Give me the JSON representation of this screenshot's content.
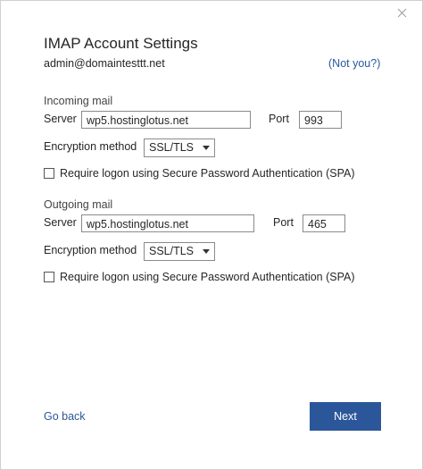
{
  "dialog": {
    "title": "IMAP Account Settings",
    "account_email": "admin@domaintesttt.net",
    "not_you_link": "(Not you?)",
    "close_icon": "close-icon"
  },
  "incoming": {
    "section_label": "Incoming mail",
    "server_label": "Server",
    "server_value": "wp5.hostinglotus.net",
    "port_label": "Port",
    "port_value": "993",
    "encryption_label": "Encryption method",
    "encryption_value": "SSL/TLS",
    "spa_label": "Require logon using Secure Password Authentication (SPA)",
    "spa_checked": false
  },
  "outgoing": {
    "section_label": "Outgoing mail",
    "server_label": "Server",
    "server_value": "wp5.hostinglotus.net",
    "port_label": "Port",
    "port_value": "465",
    "encryption_label": "Encryption method",
    "encryption_value": "SSL/TLS",
    "spa_label": "Require logon using Secure Password Authentication (SPA)",
    "spa_checked": false
  },
  "footer": {
    "go_back_label": "Go back",
    "next_label": "Next"
  },
  "colors": {
    "accent": "#2b579a",
    "text": "#262626"
  }
}
